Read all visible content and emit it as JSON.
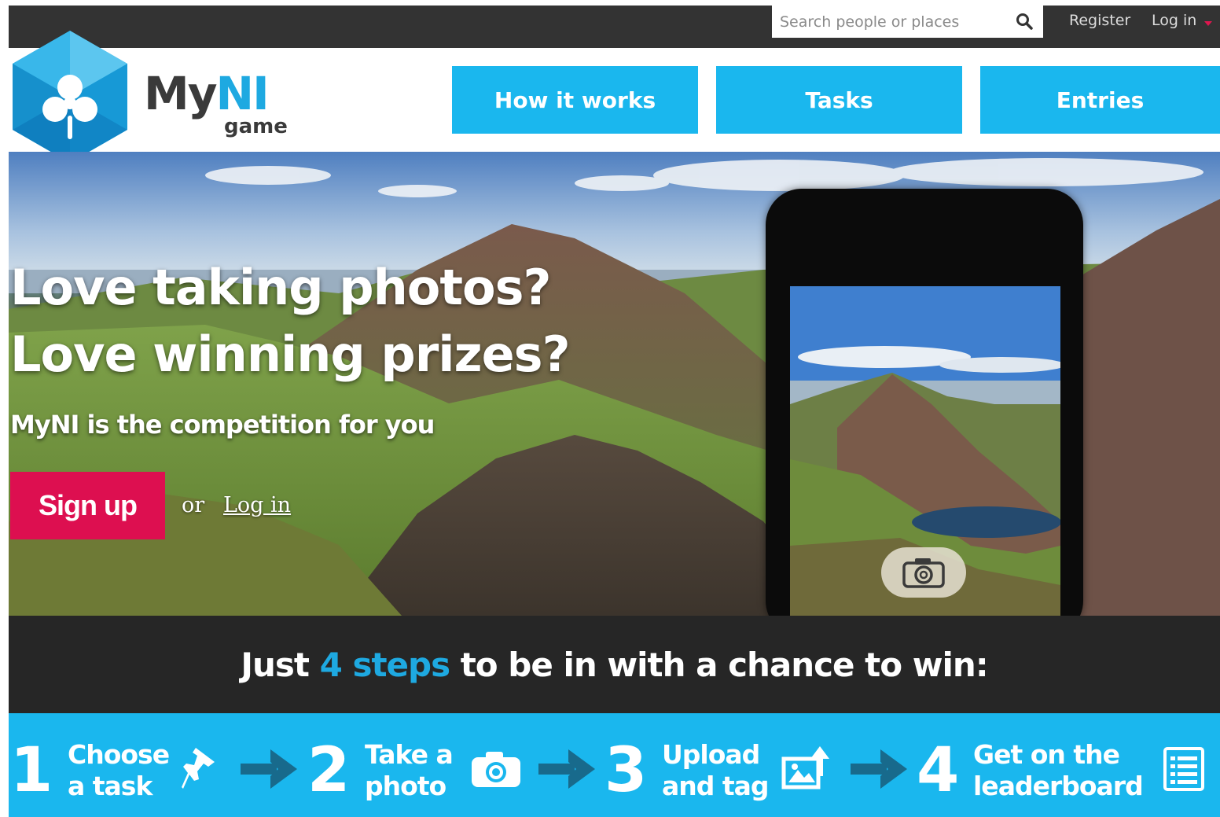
{
  "top_bar": {
    "search_placeholder": "Search people or places",
    "register": "Register",
    "login": "Log in"
  },
  "brand": {
    "my": "My",
    "ni": "NI",
    "sub": "game"
  },
  "nav": [
    {
      "label": "How it works"
    },
    {
      "label": "Tasks"
    },
    {
      "label": "Entries"
    }
  ],
  "hero": {
    "line1": "Love taking photos?",
    "line2": "Love winning prizes?",
    "tagline": "MyNI is the competition for you",
    "signup": "Sign up",
    "or": "or",
    "login": "Log in"
  },
  "steps_heading": {
    "before": "Just ",
    "highlight": "4 steps",
    "after": " to be in with a chance to win:"
  },
  "steps": [
    {
      "number": "1",
      "line1": "Choose",
      "line2": "a task",
      "icon": "pushpin-icon"
    },
    {
      "number": "2",
      "line1": "Take a",
      "line2": "photo",
      "icon": "camera-icon"
    },
    {
      "number": "3",
      "line1": "Upload",
      "line2": "and tag",
      "icon": "upload-image-icon"
    },
    {
      "number": "4",
      "line1": "Get on the",
      "line2": "leaderboard",
      "icon": "list-icon"
    }
  ],
  "colors": {
    "accent_blue": "#1ab7ee",
    "signup_red": "#dd0f50",
    "top_bar": "#333333",
    "steps_bar": "#262626",
    "arrow": "#186a8c"
  }
}
